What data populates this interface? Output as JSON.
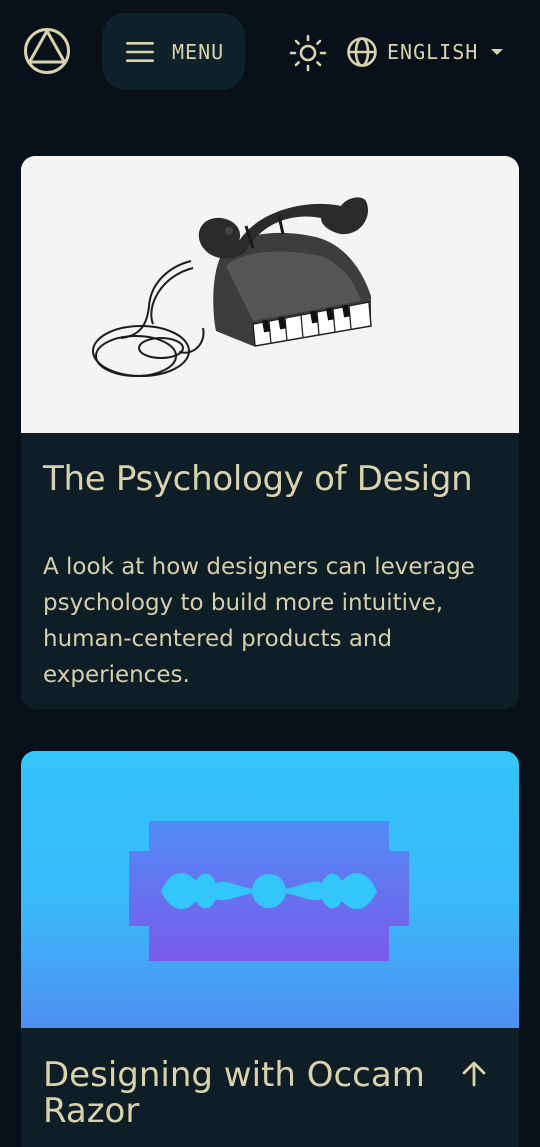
{
  "header": {
    "logo_icon": "site-logo-circle-triangle",
    "menu_label": "MENU",
    "menu_icon": "hamburger-icon",
    "theme_icon": "sun-icon",
    "language_icon": "globe-icon",
    "language_label": "ENGLISH",
    "language_caret_icon": "caret-down-icon"
  },
  "posts": [
    {
      "title": "The Psychology of Design",
      "description": "A look at how designers can leverage psychology to build more intuitive, human-centered products and experiences.",
      "image": "telephone-with-piano-keys-illustration"
    },
    {
      "title": "Designing with Occam Razor",
      "image": "razor-blade-illustration"
    }
  ],
  "scroll_top_icon": "arrow-up-icon",
  "colors": {
    "background": "#08111a",
    "card": "#0f1e26",
    "text": "#d9d3ad",
    "razor_bg_top": "#33c6fb",
    "razor_bg_bottom": "#4f8ff2"
  }
}
